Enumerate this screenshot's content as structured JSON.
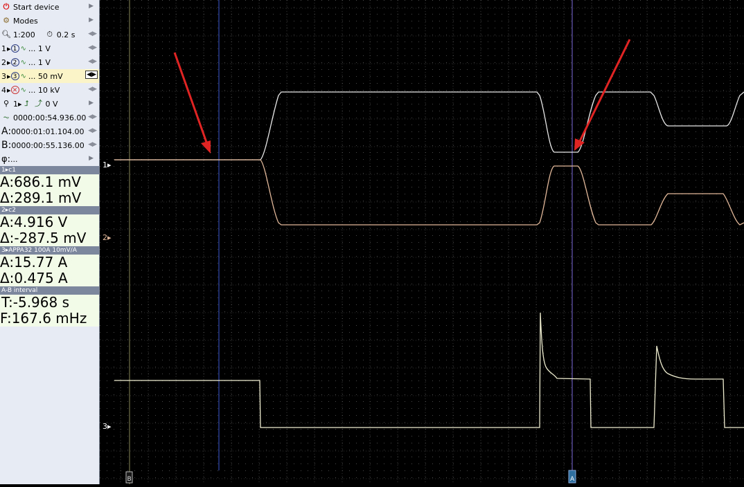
{
  "sidebar": {
    "start_device": "Start device",
    "modes": "Modes",
    "zoom": "1:200",
    "timebase": "0.2 s",
    "channels": [
      {
        "num": "1",
        "circle": "1",
        "scale": "... 1 V"
      },
      {
        "num": "2",
        "circle": "2",
        "scale": "... 1 V"
      },
      {
        "num": "3",
        "circle": "3",
        "scale": "... 50 mV"
      },
      {
        "num": "4",
        "circle": "",
        "scale": "... 10 kV"
      }
    ],
    "trigger": {
      "num": "1",
      "level": "0 V"
    },
    "trigger_time": "0000:00:54.936.00",
    "cursor_a": {
      "label": "A:",
      "value": "0000:01:01.104.00"
    },
    "cursor_b": {
      "label": "B:",
      "value": "0000:00:55.136.00"
    },
    "phi": {
      "label": "φ:",
      "value": "..."
    }
  },
  "measurements": [
    {
      "header": "1▸c1",
      "a": "A:686.1 mV",
      "delta": "Δ:289.1 mV"
    },
    {
      "header": "2▸c2",
      "a": "A:4.916 V",
      "delta": "Δ:-287.5 mV"
    },
    {
      "header": "3▸APPA32 100A 10mV/A",
      "a": "A:15.77 A",
      "delta": "Δ:0.475 A"
    },
    {
      "header": "A-B interval",
      "a": "T:-5.968 s",
      "delta": "F:167.6 mHz"
    }
  ],
  "plot": {
    "channel_labels": [
      "1▸",
      "2▸",
      "3▸"
    ],
    "cursor_labels": [
      "B",
      "A"
    ],
    "colors": {
      "ch1": "#e8e8e8",
      "ch2": "#e2b89a",
      "ch3": "#efedd0",
      "cursor_a": "#7e6de0",
      "cursor_b": "#3c57d4",
      "annotation": "#e02424",
      "grid": "#5b5b5b"
    }
  }
}
